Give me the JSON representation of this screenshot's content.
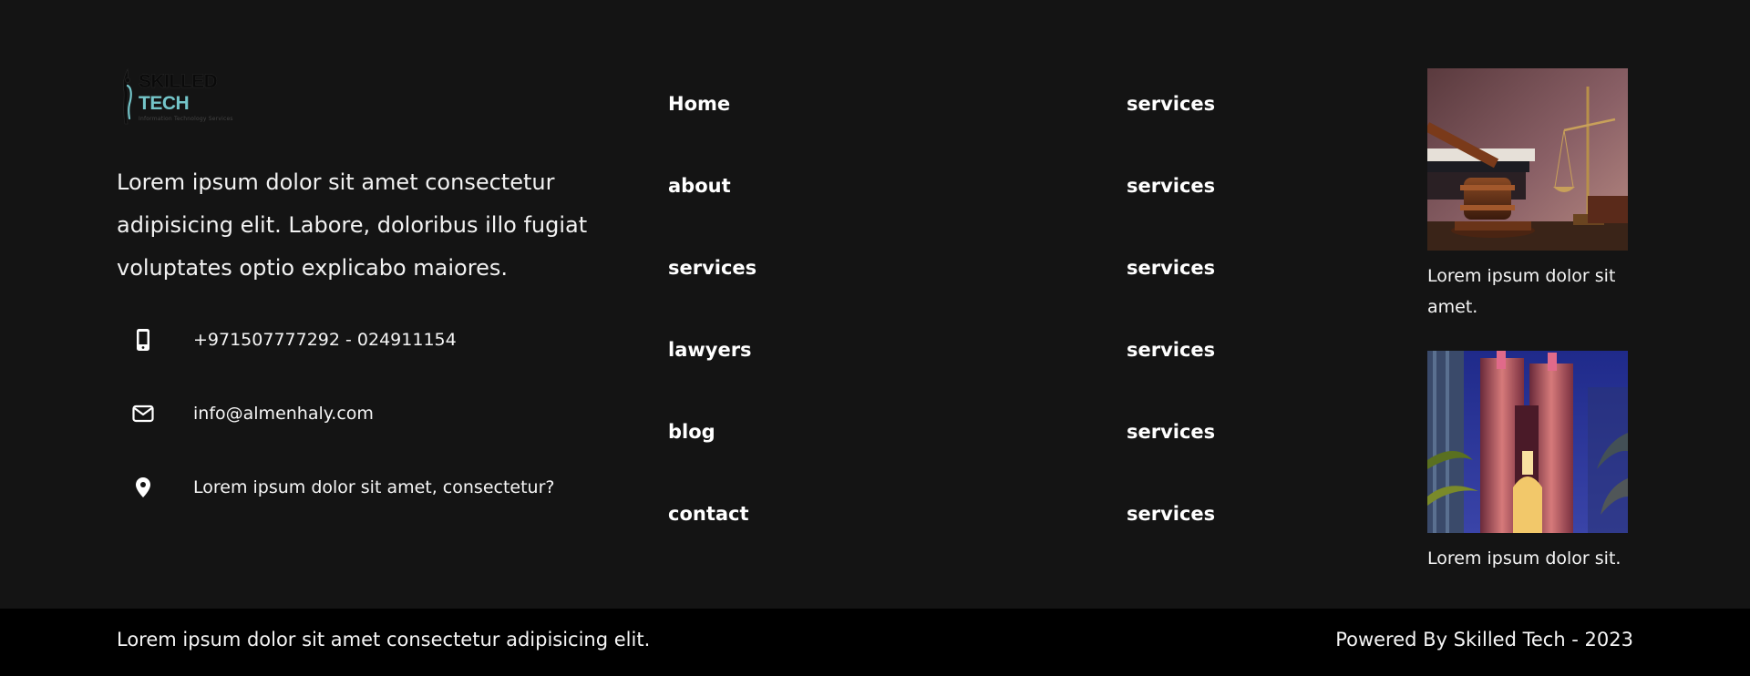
{
  "brand": {
    "name_part1": "SKILLED",
    "name_part2": "TECH",
    "tagline": "Information Technology Services",
    "accent_color": "#74c5c9"
  },
  "about": {
    "text": "Lorem ipsum dolor sit amet consectetur adipisicing elit. Labore, doloribus illo fugiat voluptates optio explicabo maiores."
  },
  "contact": {
    "phone": "+971507777292 - 024911154",
    "email": "info@almenhaly.com",
    "address": "Lorem ipsum dolor sit amet, consectetur?",
    "icons": [
      "mobile-phone-icon",
      "envelope-icon",
      "map-pin-icon"
    ]
  },
  "nav": {
    "items": [
      "Home",
      "about",
      "services",
      "lawyers",
      "blog",
      "contact"
    ]
  },
  "services": {
    "items": [
      "services",
      "services",
      "services",
      "services",
      "services",
      "services"
    ]
  },
  "posts": [
    {
      "image": "gavel-and-scales-image",
      "caption": "Lorem ipsum dolor sit amet."
    },
    {
      "image": "city-towers-night-image",
      "caption": "Lorem ipsum dolor sit."
    }
  ],
  "bottom": {
    "left_text": "Lorem ipsum dolor sit amet consectetur adipisicing elit.",
    "right_text": "Powered By Skilled Tech - 2023"
  }
}
